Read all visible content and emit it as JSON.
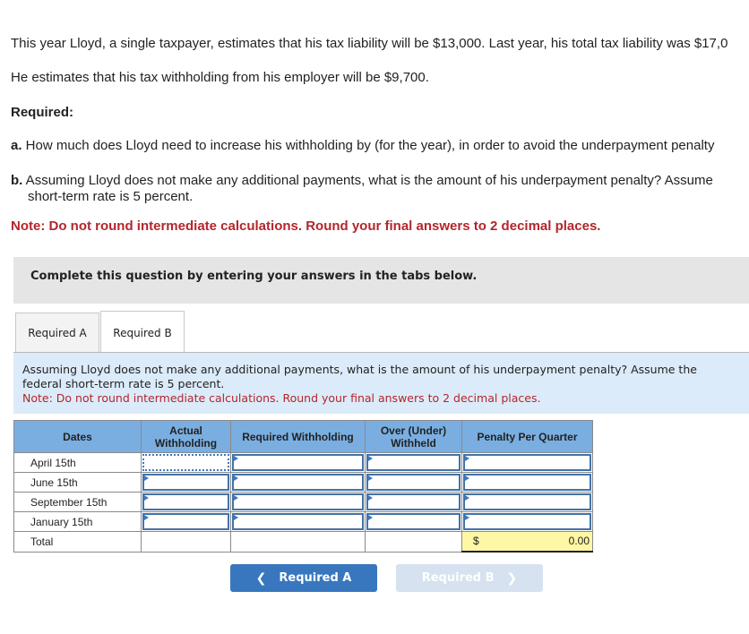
{
  "problem": {
    "intro_line1": "This year Lloyd, a single taxpayer, estimates that his tax liability will be $13,000. Last year, his total tax liability was $17,0",
    "intro_line2": "He estimates that his tax withholding from his employer will be $9,700.",
    "required_heading": "Required:",
    "part_a_label": "a.",
    "part_a_text": " How much does Lloyd need to increase his withholding by (for the year), in order to avoid the underpayment penalty",
    "part_b_label": "b.",
    "part_b_text": " Assuming Lloyd does not make any additional payments, what is the amount of his underpayment penalty? Assume",
    "part_b_text2": "short-term rate is 5 percent.",
    "note": "Note: Do not round intermediate calculations. Round your final answers to 2 decimal places."
  },
  "banner": "Complete this question by entering your answers in the tabs below.",
  "tabs": [
    {
      "label": "Required A",
      "active": false
    },
    {
      "label": "Required B",
      "active": true
    }
  ],
  "prompt": {
    "text": "Assuming Lloyd does not make any additional payments, what is the amount of his underpayment penalty? Assume the federal short-term rate is 5 percent.",
    "note": "Note: Do not round intermediate calculations. Round your final answers to 2 decimal places."
  },
  "table": {
    "headers": [
      "Dates",
      "Actual Withholding",
      "Required Withholding",
      "Over (Under) Withheld",
      "Penalty Per Quarter"
    ],
    "rows": [
      {
        "date": "April 15th",
        "actual": "",
        "required": "",
        "over_under": "",
        "penalty": ""
      },
      {
        "date": "June 15th",
        "actual": "",
        "required": "",
        "over_under": "",
        "penalty": ""
      },
      {
        "date": "September 15th",
        "actual": "",
        "required": "",
        "over_under": "",
        "penalty": ""
      },
      {
        "date": "January 15th",
        "actual": "",
        "required": "",
        "over_under": "",
        "penalty": ""
      }
    ],
    "total_label": "Total",
    "total_currency": "$",
    "total_penalty": "0.00"
  },
  "nav": {
    "prev_label": "Required A",
    "next_label": "Required B",
    "prev_icon": "chevron-left-icon",
    "next_icon": "chevron-right-icon"
  },
  "colors": {
    "accent": "#3877be",
    "header_blue": "#7aaee0",
    "note_red": "#b3262b",
    "prompt_bg": "#dcebf9",
    "total_bg": "#fdf7a6"
  }
}
